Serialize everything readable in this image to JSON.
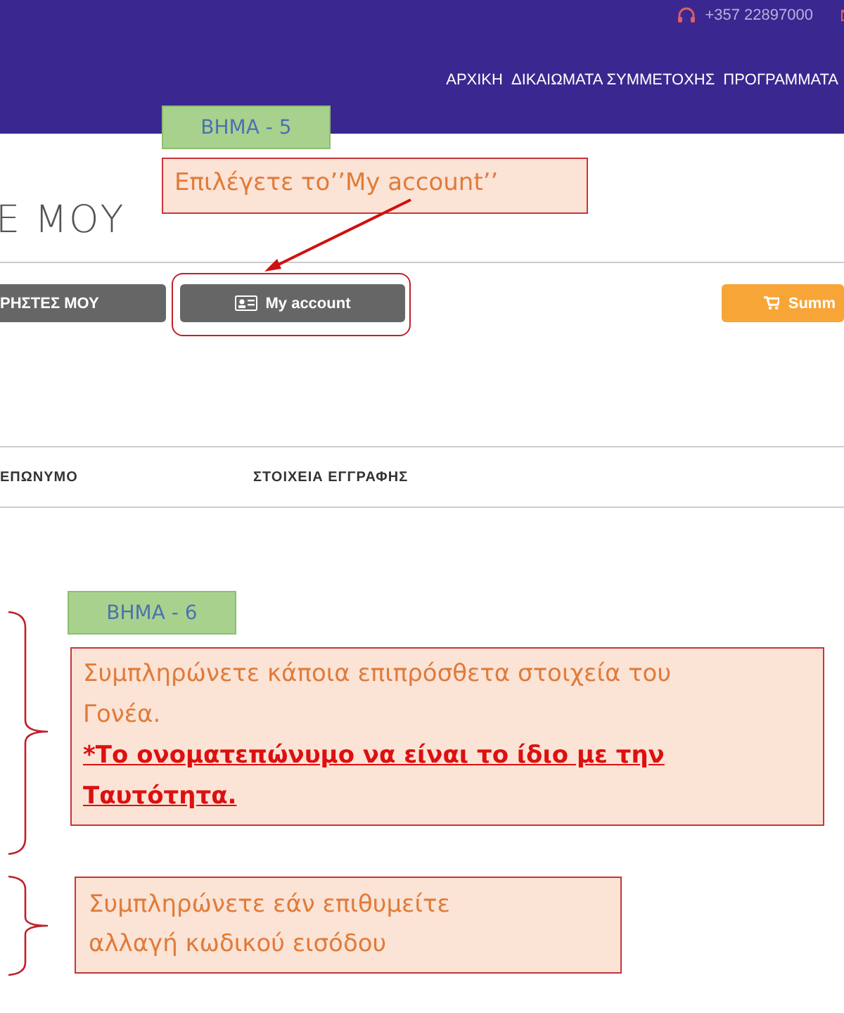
{
  "header": {
    "phone": "+357 22897000",
    "nav": [
      {
        "label": "ΑΡΧΙΚΗ"
      },
      {
        "label": "ΔΙΚΑΙΩΜΑΤΑ ΣΥΜΜΕΤΟΧΗΣ"
      },
      {
        "label": "ΠΡΟΓΡΑΜΜΑΤΑ"
      }
    ]
  },
  "page_title": "Ε ΜΟΥ",
  "buttons": [
    {
      "label": "ΡΗΣΤΕΣ ΜΟΥ",
      "kind": "plain"
    },
    {
      "label": "My account",
      "kind": "account"
    },
    {
      "label": "Summ",
      "kind": "cart"
    }
  ],
  "table": {
    "columns": [
      "ΕΠΩΝΥΜΟ",
      "ΣΤΟΙΧΕΙΑ ΕΓΓΡΑΦΗΣ"
    ]
  },
  "annotations": {
    "steps": [
      {
        "label": "ΒΗΜΑ - 5"
      },
      {
        "label": "ΒΗΜΑ - 6"
      }
    ],
    "callouts": [
      {
        "text": "Επιλέγετε το’’My account’’"
      },
      {
        "text": "Συμπληρώνετε κάποια επιπρόσθετα στοιχεία του Γονέα.",
        "warning": "*Το ονοματεπώνυμο να είναι το ίδιο με την Ταυτότητα."
      },
      {
        "text": "Συμπληρώνετε εάν επιθυμείτε αλλαγή κωδικού εισόδου"
      }
    ]
  }
}
